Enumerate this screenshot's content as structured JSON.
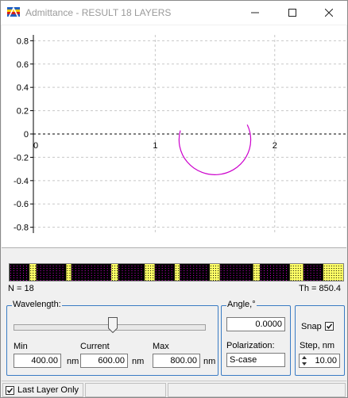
{
  "window": {
    "title": "Admittance - RESULT 18 LAYERS",
    "controls": [
      "minimize",
      "maximize",
      "close"
    ]
  },
  "plot": {
    "type": "admittance-locus",
    "x_ticks": [
      "0",
      "1",
      "2"
    ],
    "y_ticks": [
      "0.8",
      "0.6",
      "0.4",
      "0.2",
      "0",
      "-0.2",
      "-0.4",
      "-0.6",
      "-0.8"
    ],
    "x_values": [
      0,
      1,
      2
    ],
    "y_values": [
      0.8,
      0.6,
      0.4,
      0.2,
      0,
      -0.2,
      -0.4,
      -0.6,
      -0.8
    ],
    "xlim": [
      -0.02,
      2.6
    ],
    "ylim": [
      -0.85,
      0.85
    ],
    "locus": {
      "center": [
        1.5,
        0.02
      ],
      "radius": 0.3,
      "start_point": [
        1.21,
        0.03
      ],
      "end_point": [
        1.77,
        0.08
      ],
      "color": "#cc00cc"
    },
    "grid": "dashed",
    "zero_line": "dashed"
  },
  "stack": {
    "n_label": "N = 18",
    "th_label": "Th = 850.4",
    "layer_colors": [
      "#000000",
      "#ffff66",
      "#cc00cc"
    ]
  },
  "wavelength": {
    "legend": "Wavelength:",
    "slider_fraction": 0.5,
    "min_label": "Min",
    "min_value": "400.00",
    "current_label": "Current",
    "current_value": "600.00",
    "max_label": "Max",
    "max_value": "800.00",
    "unit": "nm"
  },
  "angle": {
    "legend": "Angle,°",
    "value": "0.0000",
    "polarization_label": "Polarization:",
    "polarization_value": "S-case"
  },
  "snap": {
    "label": "Snap",
    "checked": true,
    "step_label": "Step, nm",
    "step_value": "10.00"
  },
  "status": {
    "last_layer_label": "Last Layer Only",
    "last_layer_checked": true
  }
}
